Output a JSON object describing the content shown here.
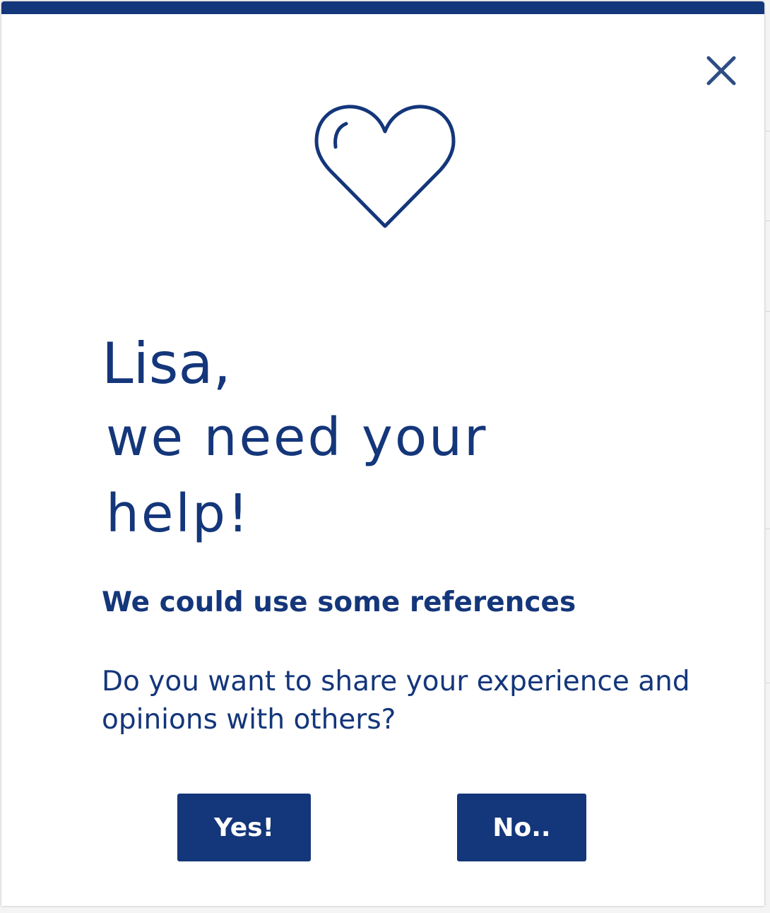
{
  "dialog": {
    "close_icon": "close-icon",
    "illustration_icon": "heart-icon",
    "greeting_name": "Lisa,",
    "greeting_line1": "we need your",
    "greeting_line2": "help!",
    "subheading": "We could use some references",
    "body": "Do you want to share your experience and opinions with others?",
    "yes_label": "Yes!",
    "no_label": "No.."
  },
  "colors": {
    "primary": "#14367a",
    "background": "#ffffff",
    "button_text": "#ffffff"
  }
}
